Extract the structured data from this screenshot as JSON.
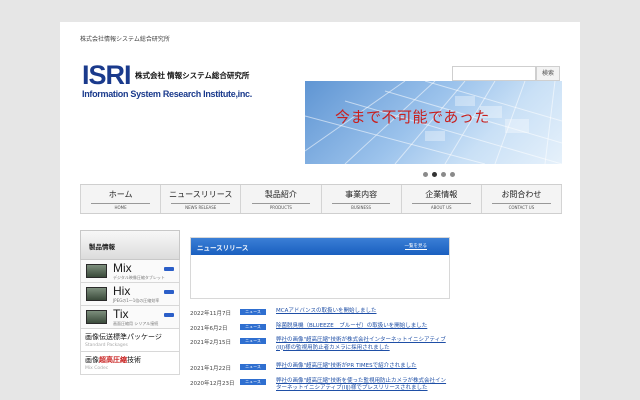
{
  "header": {
    "company_small": "株式会社情報システム総合研究所",
    "logo": {
      "mark": "ISRI",
      "jp_name": "株式会社 情報システム総合研究所",
      "en_name": "Information System Research Institute,inc."
    },
    "search": {
      "placeholder": "",
      "button_label": "検索"
    }
  },
  "hero": {
    "text": "今まで不可能であった",
    "slides": 4,
    "active_slide": 2
  },
  "nav": [
    {
      "label": "ホーム",
      "sub": "HOME"
    },
    {
      "label": "ニュースリリース",
      "sub": "NEWS RELEASE"
    },
    {
      "label": "製品紹介",
      "sub": "PRODUCTS"
    },
    {
      "label": "事業内容",
      "sub": "BUSINESS"
    },
    {
      "label": "企業情報",
      "sub": "ABOUT US"
    },
    {
      "label": "お問合わせ",
      "sub": "CONTACT US"
    }
  ],
  "sidebar": {
    "title": "製品情報",
    "products": [
      {
        "name": "Mix",
        "desc": "デジタル映像圧縮タブレット"
      },
      {
        "name": "Hix",
        "desc": "JPEGの1～1倍の圧縮効率"
      },
      {
        "name": "Tix",
        "desc": "画面圧縮用 シリアル接続"
      }
    ],
    "links": [
      {
        "title": "画像伝送標準パッケージ",
        "sub": "Standard Packages"
      },
      {
        "title_plain": "画像",
        "title_highlight": "超高圧縮",
        "title_end": "技術",
        "sub": "Mix Codec"
      }
    ]
  },
  "news": {
    "title": "ニュースリリース",
    "more": "一覧を見る",
    "items": [
      {
        "date": "2022年11月7日",
        "tag": "ニュース",
        "text": "MCAアドバンスの取扱いを開始しました"
      },
      {
        "date": "2021年6月2日",
        "tag": "ニュース",
        "text": "除菌脱臭機（BLUEEZE　ブルーゼ）の取扱いを開始しました"
      },
      {
        "date": "2021年2月15日",
        "tag": "ニュース",
        "text": "弊社の画像\"超高圧縮\"技術が株式会社インターネットイニシアティブ(IIJ)様の監視用防止者カメラに採用されました"
      },
      {
        "date": "2021年1月22日",
        "tag": "ニュース",
        "text": "弊社の画像\"超高圧縮\"技術がPR TIMESで紹介されました"
      },
      {
        "date": "2020年12月23日",
        "tag": "ニュース",
        "text": "弊社の画像\"超高圧縮\"技術を使った監視用防止カメラが株式会社インターネットイニシアティブ(IIJ)様でプレスリリースされました"
      }
    ]
  },
  "colors": {
    "brand": "#1a3a8c",
    "accent": "#2f6fd0",
    "hero_text": "#c8201f"
  }
}
